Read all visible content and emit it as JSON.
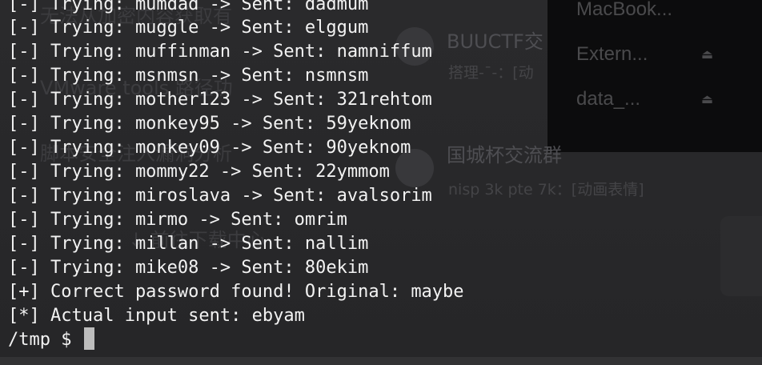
{
  "background": {
    "finder_items": [
      "MacBook...",
      "Extern...",
      "data_..."
    ],
    "chat_title_1": "BUUCTF交",
    "chat_sub_1": "搭理-¯-：[动",
    "chat_title_2": "国城杯交流群",
    "chat_sub_2": "nisp 3k pte 7k：[动画表情]",
    "ghost_1": "无法从加密内容获取有",
    "ghost_2": "VMware tools 路径功",
    "ghost_3": "脚本安全注入漏洞分析",
    "ghost_4": "↓ 前往下载中心"
  },
  "terminal": {
    "lines": [
      "[-] Trying: mumdad -> Sent: dadmum",
      "[-] Trying: muggle -> Sent: elggum",
      "[-] Trying: muffinman -> Sent: namniffum",
      "[-] Trying: msnmsn -> Sent: nsmnsm",
      "[-] Trying: mother123 -> Sent: 321rehtom",
      "[-] Trying: monkey95 -> Sent: 59yeknom",
      "[-] Trying: monkey09 -> Sent: 90yeknom",
      "[-] Trying: mommy22 -> Sent: 22ymmom",
      "[-] Trying: miroslava -> Sent: avalsorim",
      "[-] Trying: mirmo -> Sent: omrim",
      "[-] Trying: millan -> Sent: nallim",
      "[-] Trying: mike08 -> Sent: 80ekim",
      "[+] Correct password found! Original: maybe",
      "[*] Actual input sent: ebyam"
    ],
    "prompt": "/tmp $ "
  }
}
